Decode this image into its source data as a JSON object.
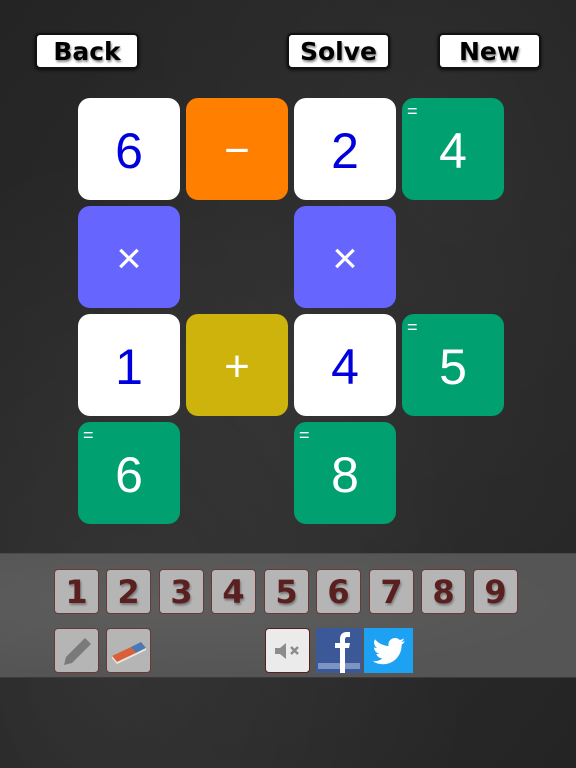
{
  "header": {
    "back_label": "Back",
    "solve_label": "Solve",
    "new_label": "New"
  },
  "puzzle": {
    "colors": {
      "number_bg": "#ffffff",
      "number_text": "#0000dd",
      "minus_bg": "#ff8000",
      "plus_bg": "#cdb30c",
      "times_bg": "#6666ff",
      "result_bg": "#00a070"
    },
    "result_prefix": "=",
    "row1": {
      "a": "6",
      "op": "−",
      "b": "2",
      "result": "4"
    },
    "col_ops": {
      "col1": "×",
      "col3": "×"
    },
    "row3": {
      "a": "1",
      "op": "+",
      "b": "4",
      "result": "5"
    },
    "col_results": {
      "col1": "6",
      "col3": "8"
    }
  },
  "toolbar": {
    "keys": [
      "1",
      "2",
      "3",
      "4",
      "5",
      "6",
      "7",
      "8",
      "9"
    ],
    "tools": {
      "pencil": "pencil-icon",
      "eraser": "eraser-icon",
      "mute": "speaker-muted-icon",
      "facebook": "facebook-icon",
      "twitter": "twitter-icon"
    }
  }
}
